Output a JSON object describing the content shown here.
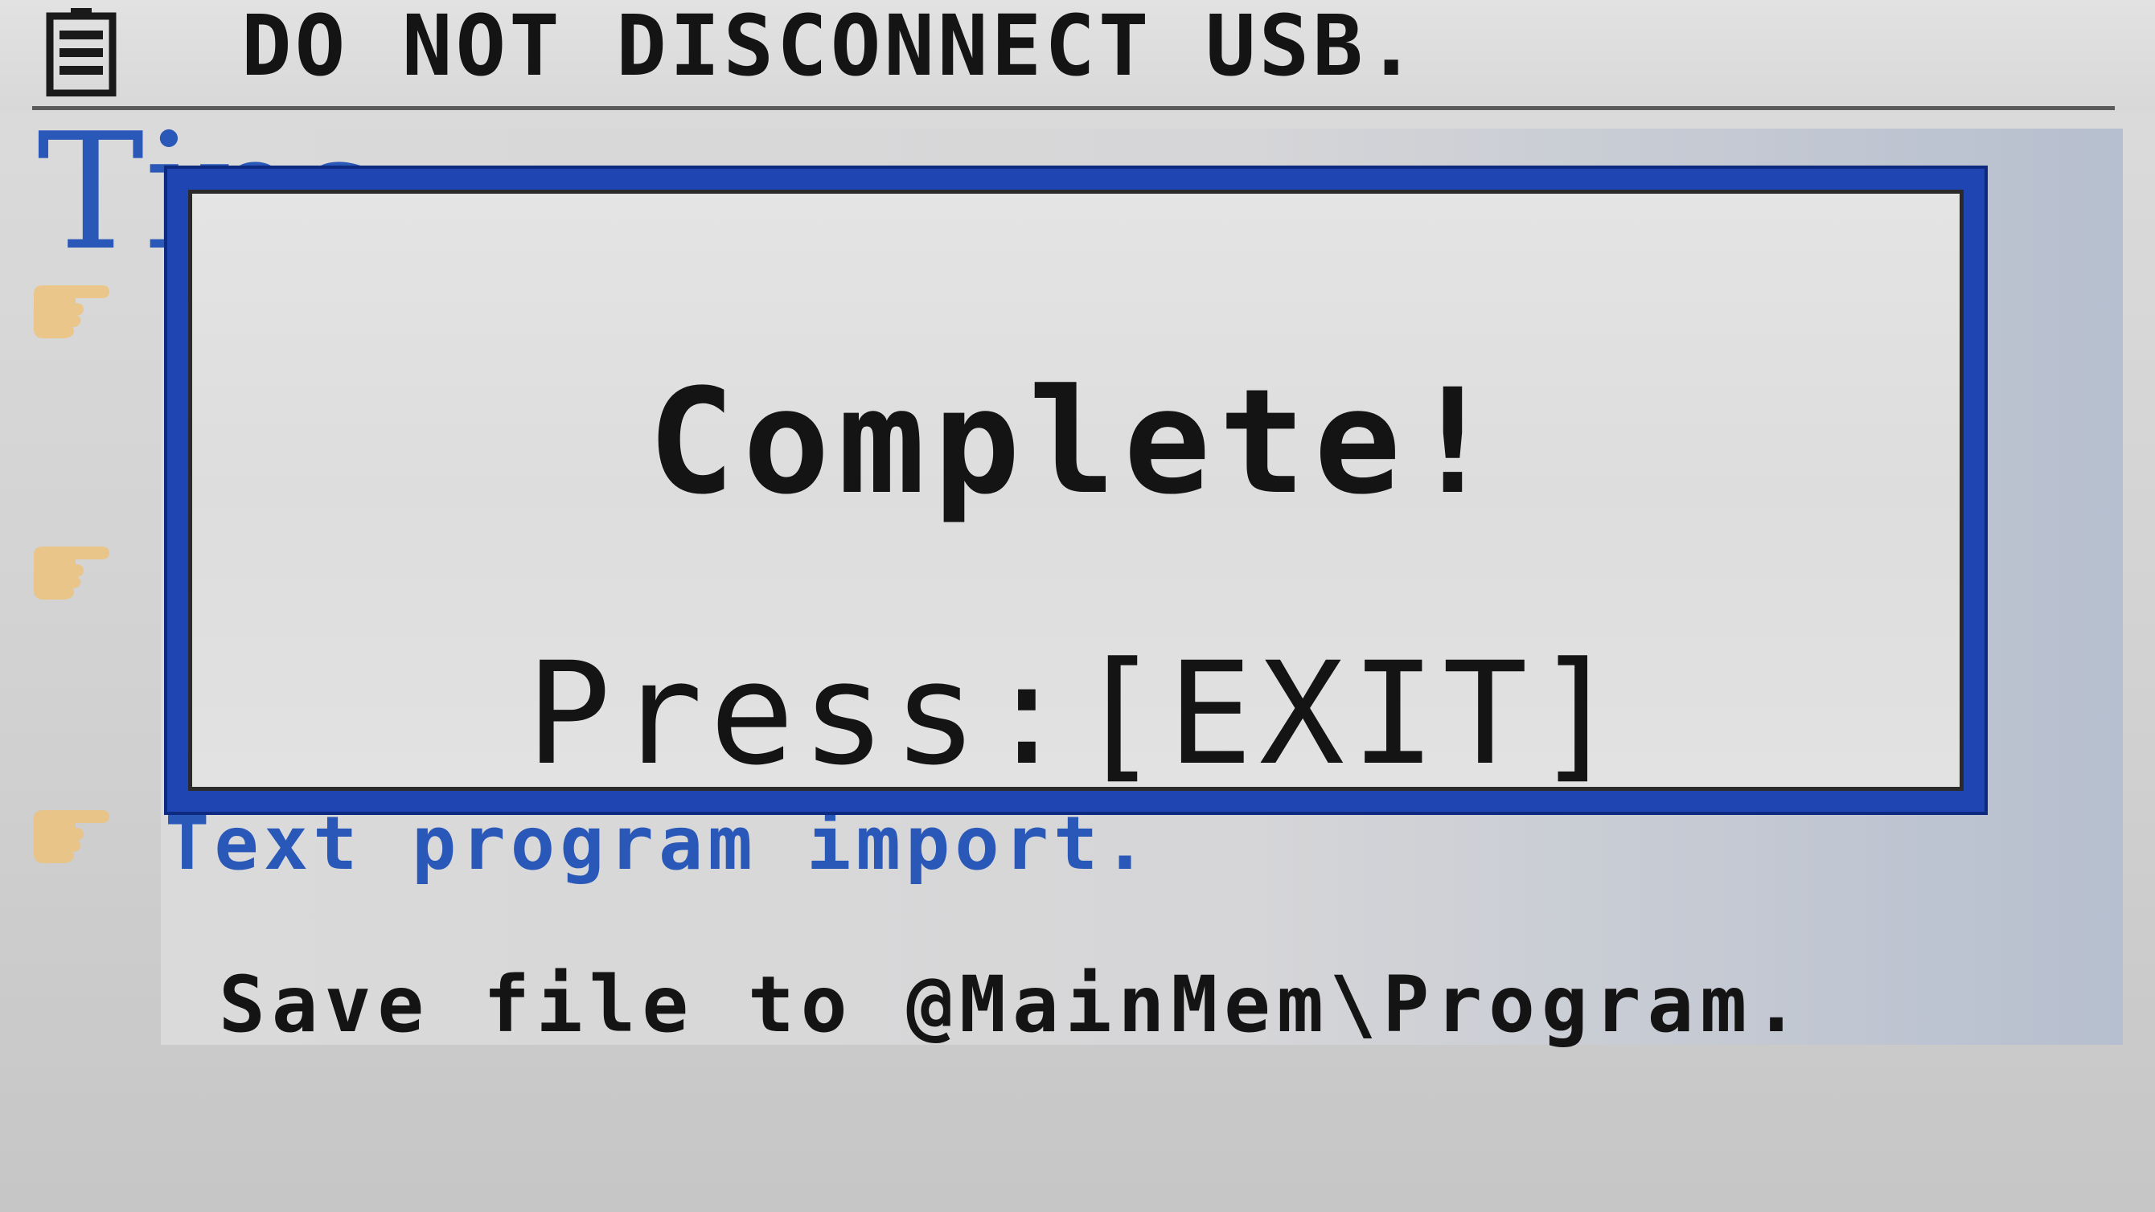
{
  "status_bar": {
    "battery_icon": "battery-icon",
    "message": "DO NOT DISCONNECT USB."
  },
  "tip_screen": {
    "heading_fragment": "Tips",
    "item_icon": "pointing-hand-icon",
    "items": [
      {
        "label": "Text program import.",
        "detail": "Save file to @MainMem\\Program."
      }
    ]
  },
  "dialog": {
    "message": "Complete!",
    "instruction": "Press:[EXIT]"
  },
  "colors": {
    "dialog_border": "#1f45b3",
    "tip_text": "#2a58b8",
    "hand_icon": "#f0c070"
  }
}
